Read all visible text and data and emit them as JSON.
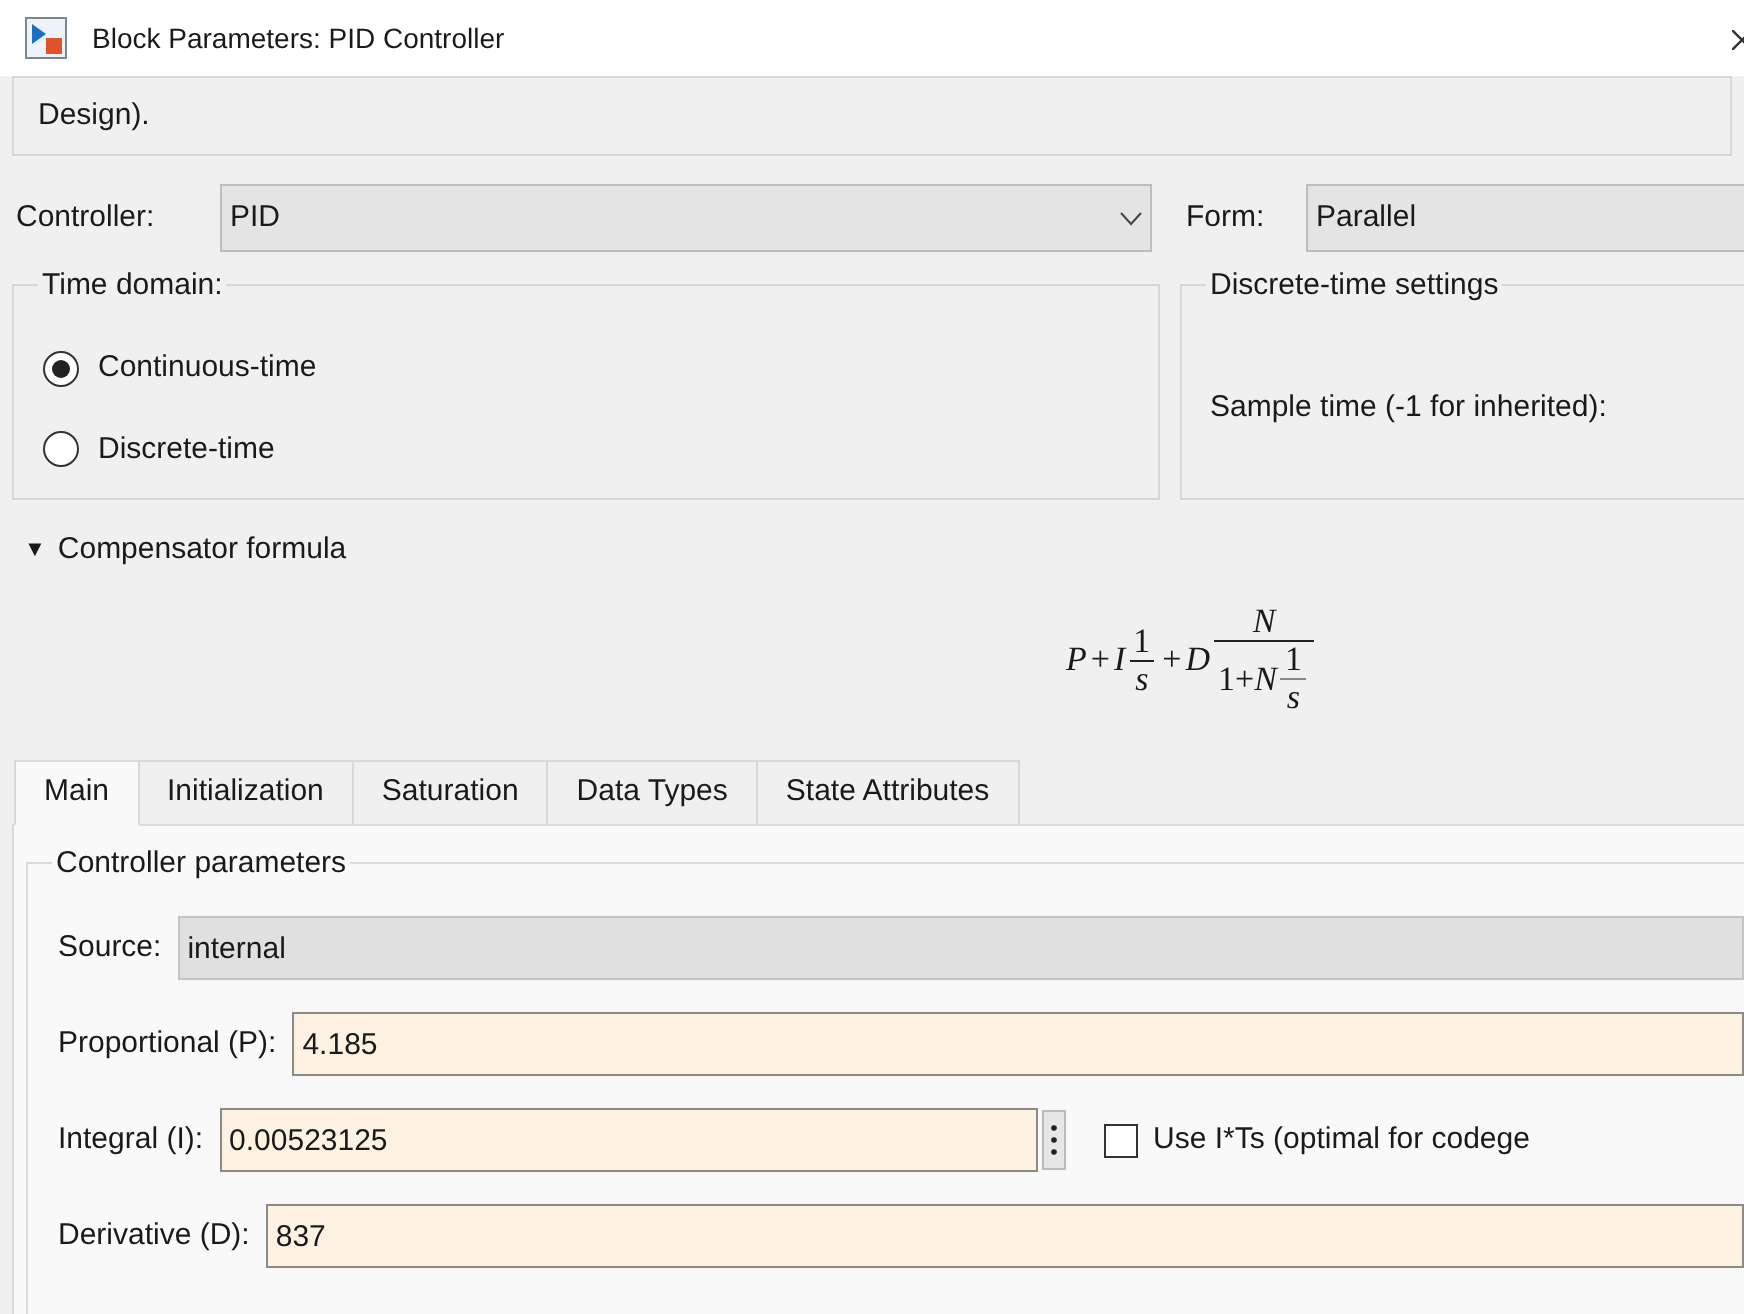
{
  "window": {
    "title": "Block Parameters: PID Controller"
  },
  "description": "Design).",
  "controller": {
    "label": "Controller:",
    "value": "PID"
  },
  "form": {
    "label": "Form:",
    "value": "Parallel"
  },
  "time_domain": {
    "title": "Time domain:",
    "options": [
      {
        "label": "Continuous-time",
        "selected": true
      },
      {
        "label": "Discrete-time",
        "selected": false
      }
    ]
  },
  "discrete_settings": {
    "title": "Discrete-time settings",
    "sample_time_label": "Sample time (-1 for inherited):"
  },
  "compensator": {
    "toggle": "▼",
    "label": "Compensator formula",
    "expanded": true,
    "formula": [
      {
        "kind": "sym",
        "text": "P"
      },
      {
        "kind": "op",
        "text": "+"
      },
      {
        "kind": "sym",
        "text": "I"
      },
      {
        "kind": "frac",
        "num": [
          {
            "kind": "num",
            "text": "1"
          }
        ],
        "den": [
          {
            "kind": "sym",
            "text": "s"
          }
        ]
      },
      {
        "kind": "op",
        "text": "+"
      },
      {
        "kind": "sym",
        "text": "D"
      },
      {
        "kind": "frac",
        "num": [
          {
            "kind": "sym",
            "text": "N"
          }
        ],
        "den": [
          {
            "kind": "num",
            "text": "1+"
          },
          {
            "kind": "sym",
            "text": "N"
          },
          {
            "kind": "frac",
            "num": [
              {
                "kind": "num",
                "text": "1"
              }
            ],
            "den": [
              {
                "kind": "sym",
                "text": "s"
              }
            ]
          }
        ]
      }
    ]
  },
  "tabs": [
    {
      "label": "Main",
      "selected": true
    },
    {
      "label": "Initialization",
      "selected": false
    },
    {
      "label": "Saturation",
      "selected": false
    },
    {
      "label": "Data Types",
      "selected": false
    },
    {
      "label": "State Attributes",
      "selected": false
    }
  ],
  "controller_parameters": {
    "title": "Controller parameters",
    "source": {
      "label": "Source:",
      "value": "internal"
    },
    "proportional": {
      "label": "Proportional (P):",
      "value": "4.185"
    },
    "integral": {
      "label": "Integral (I):",
      "value": "0.00523125",
      "use_its": {
        "label": "Use I*Ts (optimal for codege",
        "checked": false
      }
    },
    "derivative": {
      "label": "Derivative (D):",
      "value": "837"
    }
  }
}
